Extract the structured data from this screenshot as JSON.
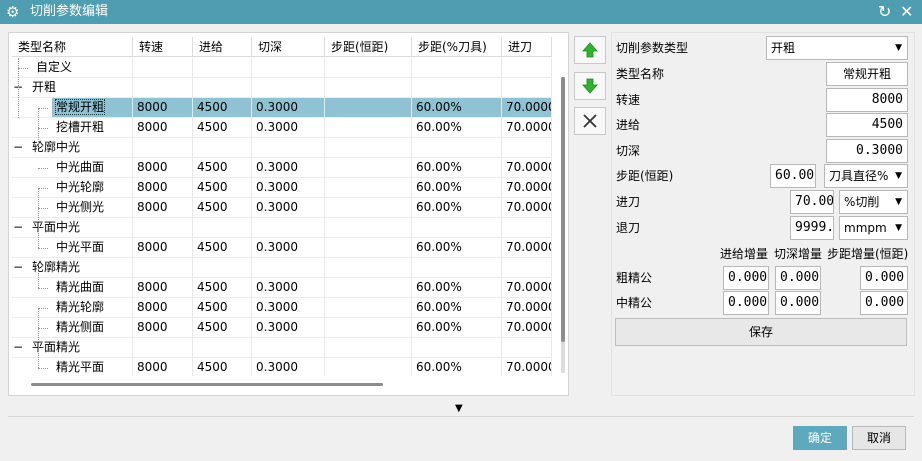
{
  "window": {
    "title": "切削参数编辑",
    "gear_icon": "gear-icon",
    "refresh_icon": "refresh-icon",
    "close_icon": "close-icon"
  },
  "table": {
    "columns": [
      "类型名称",
      "转速",
      "进给",
      "切深",
      "步距(恒距)",
      "步距(%刀具)",
      "进刀"
    ],
    "rows": [
      {
        "level": 1,
        "expander": "",
        "name": "自定义",
        "speed": "",
        "feed": "",
        "depth": "",
        "step_const": "",
        "step_pct": "",
        "entry": "",
        "selected": false
      },
      {
        "level": 0,
        "expander": "−",
        "name": "开粗",
        "speed": "",
        "feed": "",
        "depth": "",
        "step_const": "",
        "step_pct": "",
        "entry": "",
        "selected": false
      },
      {
        "level": 2,
        "expander": "",
        "name": "常规开粗",
        "speed": "8000",
        "feed": "4500",
        "depth": "0.3000",
        "step_const": "",
        "step_pct": "60.00%",
        "entry": "70.0000",
        "selected": true
      },
      {
        "level": 2,
        "expander": "",
        "name": "挖槽开粗",
        "speed": "8000",
        "feed": "4500",
        "depth": "0.3000",
        "step_const": "",
        "step_pct": "60.00%",
        "entry": "70.0000",
        "selected": false
      },
      {
        "level": 0,
        "expander": "−",
        "name": "轮廓中光",
        "speed": "",
        "feed": "",
        "depth": "",
        "step_const": "",
        "step_pct": "",
        "entry": "",
        "selected": false
      },
      {
        "level": 2,
        "expander": "",
        "name": "中光曲面",
        "speed": "8000",
        "feed": "4500",
        "depth": "0.3000",
        "step_const": "",
        "step_pct": "60.00%",
        "entry": "70.0000",
        "selected": false
      },
      {
        "level": 2,
        "expander": "",
        "name": "中光轮廓",
        "speed": "8000",
        "feed": "4500",
        "depth": "0.3000",
        "step_const": "",
        "step_pct": "60.00%",
        "entry": "70.0000",
        "selected": false
      },
      {
        "level": 2,
        "expander": "",
        "name": "中光侧光",
        "speed": "8000",
        "feed": "4500",
        "depth": "0.3000",
        "step_const": "",
        "step_pct": "60.00%",
        "entry": "70.0000",
        "selected": false
      },
      {
        "level": 0,
        "expander": "−",
        "name": "平面中光",
        "speed": "",
        "feed": "",
        "depth": "",
        "step_const": "",
        "step_pct": "",
        "entry": "",
        "selected": false
      },
      {
        "level": 2,
        "expander": "",
        "name": "中光平面",
        "speed": "8000",
        "feed": "4500",
        "depth": "0.3000",
        "step_const": "",
        "step_pct": "60.00%",
        "entry": "70.0000",
        "selected": false
      },
      {
        "level": 0,
        "expander": "−",
        "name": "轮廓精光",
        "speed": "",
        "feed": "",
        "depth": "",
        "step_const": "",
        "step_pct": "",
        "entry": "",
        "selected": false
      },
      {
        "level": 2,
        "expander": "",
        "name": "精光曲面",
        "speed": "8000",
        "feed": "4500",
        "depth": "0.3000",
        "step_const": "",
        "step_pct": "60.00%",
        "entry": "70.0000",
        "selected": false
      },
      {
        "level": 2,
        "expander": "",
        "name": "精光轮廓",
        "speed": "8000",
        "feed": "4500",
        "depth": "0.3000",
        "step_const": "",
        "step_pct": "60.00%",
        "entry": "70.0000",
        "selected": false
      },
      {
        "level": 2,
        "expander": "",
        "name": "精光侧面",
        "speed": "8000",
        "feed": "4500",
        "depth": "0.3000",
        "step_const": "",
        "step_pct": "60.00%",
        "entry": "70.0000",
        "selected": false
      },
      {
        "level": 0,
        "expander": "−",
        "name": "平面精光",
        "speed": "",
        "feed": "",
        "depth": "",
        "step_const": "",
        "step_pct": "",
        "entry": "",
        "selected": false
      },
      {
        "level": 2,
        "expander": "",
        "name": "精光平面",
        "speed": "8000",
        "feed": "4500",
        "depth": "0.3000",
        "step_const": "",
        "step_pct": "60.00%",
        "entry": "70.0000",
        "selected": false
      }
    ]
  },
  "side_buttons": {
    "up_icon": "arrow-up-icon",
    "down_icon": "arrow-down-icon",
    "delete_icon": "delete-x-icon"
  },
  "form": {
    "type_label": "切削参数类型",
    "type_value": "开粗",
    "name_label": "类型名称",
    "name_value": "常规开粗",
    "speed_label": "转速",
    "speed_value": "8000",
    "feed_label": "进给",
    "feed_value": "4500",
    "depth_label": "切深",
    "depth_value": "0.3000",
    "step_label": "步距(恒距)",
    "step_value": "60.00",
    "step_unit": "刀具直径%",
    "entry_label": "进刀",
    "entry_value": "70.00",
    "entry_unit": "%切削",
    "retract_label": "退刀",
    "retract_value": "9999.",
    "retract_unit": "mmpm",
    "inc_feed_header": "进给增量",
    "inc_depth_header": "切深增量",
    "inc_step_header": "步距增量(恒距)",
    "rough_label": "粗精公",
    "rough_feed": "0.000",
    "rough_depth": "0.000",
    "rough_step": "0.000",
    "mid_label": "中精公",
    "mid_feed": "0.000",
    "mid_depth": "0.000",
    "mid_step": "0.000",
    "save_label": "保存"
  },
  "footer": {
    "expand_icon": "triangle-down-icon",
    "ok_label": "确定",
    "cancel_label": "取消"
  },
  "colors": {
    "titlebar": "#4f9db0",
    "selection": "#8fc3d4",
    "ok_button": "#5ea9be",
    "arrow_green": "#2db32d"
  }
}
